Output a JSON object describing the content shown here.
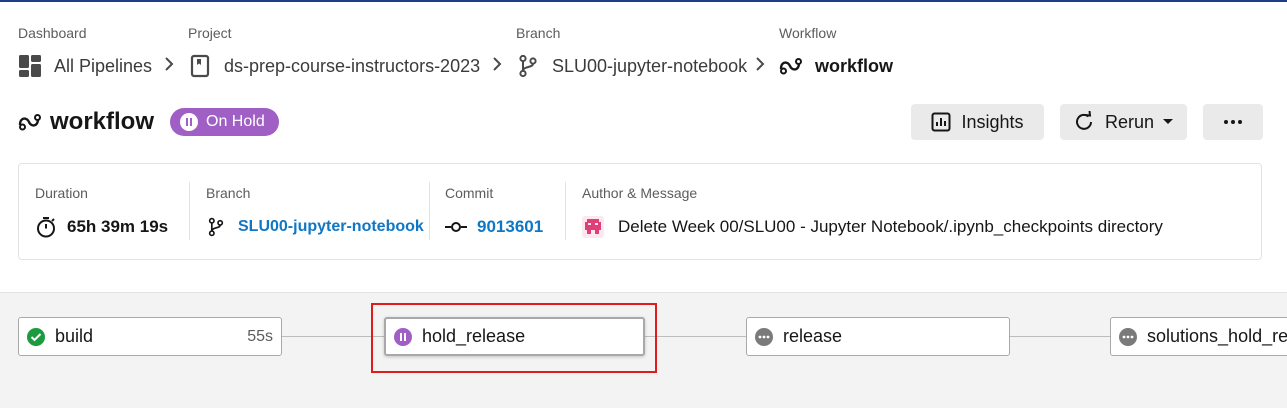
{
  "breadcrumbs": [
    {
      "label": "Dashboard",
      "value": "All Pipelines",
      "icon": "dashboard-icon"
    },
    {
      "label": "Project",
      "value": "ds-prep-course-instructors-2023",
      "icon": "project-icon"
    },
    {
      "label": "Branch",
      "value": "SLU00-jupyter-notebook",
      "icon": "branch-icon"
    },
    {
      "label": "Workflow",
      "value": "workflow",
      "icon": "workflow-icon"
    }
  ],
  "header": {
    "title": "workflow",
    "status": "On Hold",
    "status_color": "#9f5fc4",
    "insights_label": "Insights",
    "rerun_label": "Rerun",
    "more_label": "..."
  },
  "info": {
    "duration_label": "Duration",
    "duration_value": "65h 39m 19s",
    "branch_label": "Branch",
    "branch_value": "SLU00-jupyter-notebook",
    "commit_label": "Commit",
    "commit_value": "9013601",
    "author_label": "Author & Message",
    "message": "Delete Week 00/SLU00 - Jupyter Notebook/.ipynb_checkpoints directory"
  },
  "jobs": [
    {
      "name": "build",
      "duration": "55s",
      "status": "success"
    },
    {
      "name": "hold_release",
      "duration": "",
      "status": "on-hold"
    },
    {
      "name": "release",
      "duration": "",
      "status": "blocked"
    },
    {
      "name": "solutions_hold_release",
      "duration": "",
      "status": "blocked"
    }
  ],
  "colors": {
    "success": "#1a9b3f",
    "on_hold": "#9f5fc4",
    "blocked": "#7a7a7a",
    "link": "#0f77c4",
    "highlight": "#e01b1b"
  }
}
